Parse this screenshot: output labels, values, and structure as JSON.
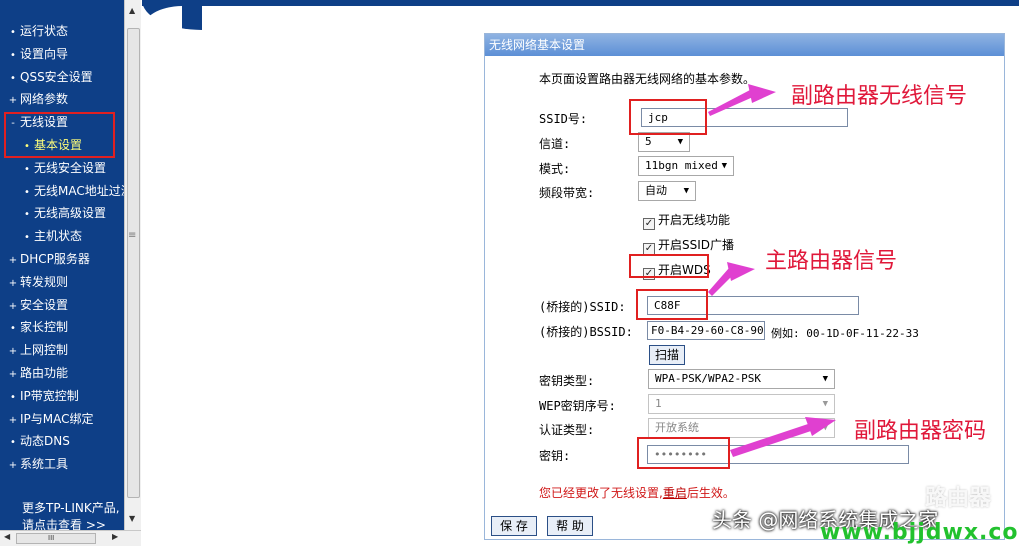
{
  "sidebar": {
    "items": [
      {
        "label": "运行状态",
        "type": "top",
        "bullet": "•"
      },
      {
        "label": "设置向导",
        "type": "top",
        "bullet": "•"
      },
      {
        "label": "QSS安全设置",
        "type": "top",
        "bullet": "•"
      },
      {
        "label": "网络参数",
        "type": "top",
        "bullet": "+"
      },
      {
        "label": "无线设置",
        "type": "top",
        "bullet": "-"
      },
      {
        "label": "基本设置",
        "type": "sub",
        "bullet": "•",
        "active": true
      },
      {
        "label": "无线安全设置",
        "type": "sub",
        "bullet": "•"
      },
      {
        "label": "无线MAC地址过滤",
        "type": "sub",
        "bullet": "•"
      },
      {
        "label": "无线高级设置",
        "type": "sub",
        "bullet": "•"
      },
      {
        "label": "主机状态",
        "type": "sub",
        "bullet": "•"
      },
      {
        "label": "DHCP服务器",
        "type": "top",
        "bullet": "+"
      },
      {
        "label": "转发规则",
        "type": "top",
        "bullet": "+"
      },
      {
        "label": "安全设置",
        "type": "top",
        "bullet": "+"
      },
      {
        "label": "家长控制",
        "type": "top",
        "bullet": "•"
      },
      {
        "label": "上网控制",
        "type": "top",
        "bullet": "+"
      },
      {
        "label": "路由功能",
        "type": "top",
        "bullet": "+"
      },
      {
        "label": "IP带宽控制",
        "type": "top",
        "bullet": "•"
      },
      {
        "label": "IP与MAC绑定",
        "type": "top",
        "bullet": "+"
      },
      {
        "label": "动态DNS",
        "type": "top",
        "bullet": "•"
      },
      {
        "label": "系统工具",
        "type": "top",
        "bullet": "+"
      }
    ],
    "more_line1": "更多TP-LINK产品,",
    "more_line2": "请点击查看 >>"
  },
  "scrollbar": {
    "up": "▲",
    "down": "▼",
    "grip": "≡",
    "left": "◀",
    "right": "▶",
    "hgrip": "III"
  },
  "panel": {
    "title": "无线网络基本设置",
    "intro": "本页面设置路由器无线网络的基本参数。",
    "ssid_label": "SSID号:",
    "ssid_value": "jcp",
    "channel_label": "信道:",
    "channel_value": "5",
    "mode_label": "模式:",
    "mode_value": "11bgn mixed",
    "bandwidth_label": "频段带宽:",
    "bandwidth_value": "自动",
    "enable_wireless": "开启无线功能",
    "enable_ssid_broadcast": "开启SSID广播",
    "enable_wds": "开启WDS",
    "bridge_ssid_label": "(桥接的)SSID:",
    "bridge_ssid_value": "C88F",
    "bridge_bssid_label": "(桥接的)BSSID:",
    "bridge_bssid_value": "F0-B4-29-60-C8-90",
    "bssid_example": "例如: 00-1D-0F-11-22-33",
    "scan_button": "扫描",
    "key_type_label": "密钥类型:",
    "key_type_value": "WPA-PSK/WPA2-PSK",
    "wep_index_label": "WEP密钥序号:",
    "wep_index_value": "1",
    "auth_type_label": "认证类型:",
    "auth_type_value": "开放系统",
    "key_label": "密钥:",
    "key_value": "••••••••",
    "notice_prefix": "您已经更改了无线设置,",
    "notice_link": "重启",
    "notice_suffix": "后生效。",
    "save_button": "保 存",
    "help_button": "帮 助",
    "caret": "▼",
    "check": "✓"
  },
  "annotations": {
    "secondary_signal": "副路由器无线信号",
    "main_signal": "主路由器信号",
    "secondary_password": "副路由器密码",
    "arrow_color": "#e040d0"
  },
  "watermark": {
    "source": "头条 @网络系统集成之家",
    "site": "www.bjjdwx.com",
    "brand": "路由器"
  }
}
